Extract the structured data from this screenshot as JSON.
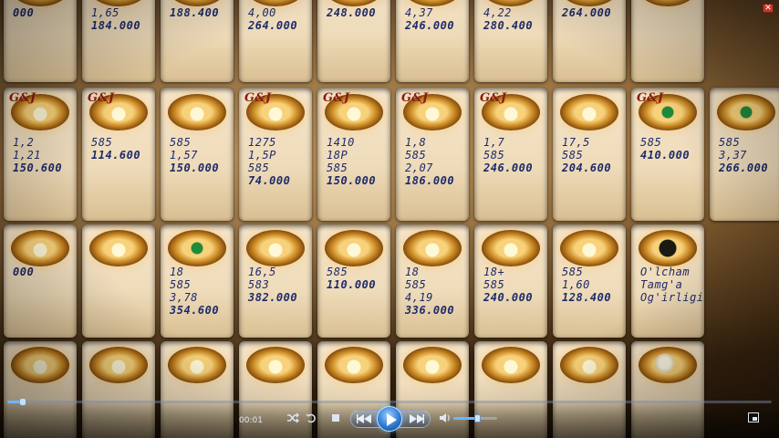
{
  "player": {
    "elapsed": "00:01",
    "progress": 0.02,
    "volume": 0.55,
    "close_glyph": "✕",
    "icons": [
      "shuffle-icon",
      "repeat-icon",
      "stop-icon",
      "previous-icon",
      "play-icon",
      "next-icon",
      "volume-icon",
      "switch-to-library-icon",
      "close-icon"
    ],
    "accent_color": "#6cb6ff"
  },
  "tags": {
    "row1": [
      {
        "logo": "",
        "lines": [
          "",
          "",
          "",
          "000"
        ],
        "gem": "plain"
      },
      {
        "logo": "",
        "lines": [
          "",
          "",
          "1,65",
          "184.000"
        ],
        "gem": "plain"
      },
      {
        "logo": "",
        "lines": [
          "",
          "",
          "",
          "188.400"
        ],
        "gem": "plain"
      },
      {
        "logo": "",
        "lines": [
          "",
          "",
          "4,00",
          "264.000"
        ],
        "gem": "plain"
      },
      {
        "logo": "",
        "lines": [
          "",
          "",
          "",
          "248.000"
        ],
        "gem": "plain"
      },
      {
        "logo": "",
        "lines": [
          "",
          "",
          "4,37",
          "246.000"
        ],
        "gem": "plain"
      },
      {
        "logo": "",
        "lines": [
          "",
          "",
          "4,22",
          "280.400"
        ],
        "gem": "plain"
      },
      {
        "logo": "",
        "lines": [
          "",
          "",
          "",
          "264.000"
        ],
        "gem": "dark"
      },
      {
        "logo": "",
        "lines": [
          "",
          "",
          "",
          ""
        ],
        "gem": "plain"
      }
    ],
    "row2": [
      {
        "logo": "G&J",
        "lines": [
          "",
          "1,2",
          "1,21",
          "150.600"
        ],
        "gem": "plain"
      },
      {
        "logo": "G&J",
        "lines": [
          "",
          "585",
          "",
          "114.600"
        ],
        "gem": "plain"
      },
      {
        "logo": "",
        "lines": [
          "",
          "585",
          "1,57",
          "150.000"
        ],
        "gem": "plain"
      },
      {
        "logo": "G&J",
        "lines": [
          "1275",
          "1,5P",
          "585",
          "74.000"
        ],
        "gem": "plain"
      },
      {
        "logo": "G&J",
        "lines": [
          "1410",
          "18P",
          "585",
          "150.000"
        ],
        "gem": "plain"
      },
      {
        "logo": "G&J",
        "lines": [
          "1,8",
          "585",
          "2,07",
          "186.000"
        ],
        "gem": "plain"
      },
      {
        "logo": "G&J",
        "lines": [
          "1,7",
          "585",
          "",
          "246.000"
        ],
        "gem": "plain"
      },
      {
        "logo": "",
        "lines": [
          "17,5",
          "585",
          "",
          "204.600"
        ],
        "gem": "plain"
      },
      {
        "logo": "G&J",
        "lines": [
          "",
          "585",
          "",
          "410.000"
        ],
        "gem": "green"
      },
      {
        "logo": "",
        "lines": [
          "",
          "585",
          "3,37",
          "266.000"
        ],
        "gem": "green"
      }
    ],
    "row3": [
      {
        "logo": "",
        "lines": [
          "",
          "",
          "",
          "000"
        ],
        "gem": "plain"
      },
      {
        "logo": "",
        "lines": [
          "",
          "",
          "",
          ""
        ],
        "gem": "plain"
      },
      {
        "logo": "",
        "lines": [
          "18",
          "585",
          "3,78",
          "354.600"
        ],
        "gem": "green"
      },
      {
        "logo": "",
        "lines": [
          "16,5",
          "583",
          "",
          "382.000"
        ],
        "gem": "plain"
      },
      {
        "logo": "",
        "lines": [
          "",
          "585",
          "",
          "110.000"
        ],
        "gem": "plain"
      },
      {
        "logo": "",
        "lines": [
          "18",
          "585",
          "4,19",
          "336.000"
        ],
        "gem": "plain"
      },
      {
        "logo": "",
        "lines": [
          "18+",
          "585",
          "",
          "240.000"
        ],
        "gem": "plain"
      },
      {
        "logo": "",
        "lines": [
          "",
          "585",
          "1,60",
          "128.400"
        ],
        "gem": "plain"
      },
      {
        "logo": "",
        "lines": [
          "O'lcham",
          "Tamg'a",
          "Og'irligi",
          ""
        ],
        "gem": "dark"
      }
    ],
    "row4": [
      {
        "logo": "",
        "lines": [
          "",
          "",
          "",
          ""
        ],
        "gem": "plain"
      },
      {
        "logo": "",
        "lines": [
          "",
          "",
          "",
          ""
        ],
        "gem": "plain"
      },
      {
        "logo": "",
        "lines": [
          "",
          "",
          "",
          ""
        ],
        "gem": "plain"
      },
      {
        "logo": "",
        "lines": [
          "",
          "",
          "",
          ""
        ],
        "gem": "plain"
      },
      {
        "logo": "",
        "lines": [
          "",
          "",
          "",
          ""
        ],
        "gem": "plain"
      },
      {
        "logo": "",
        "lines": [
          "",
          "",
          "",
          ""
        ],
        "gem": "plain"
      },
      {
        "logo": "",
        "lines": [
          "",
          "",
          "",
          ""
        ],
        "gem": "plain"
      },
      {
        "logo": "",
        "lines": [
          "",
          "",
          "",
          ""
        ],
        "gem": "plain"
      },
      {
        "logo": "",
        "lines": [
          "",
          "",
          "",
          ""
        ],
        "gem": "pearl"
      }
    ]
  }
}
